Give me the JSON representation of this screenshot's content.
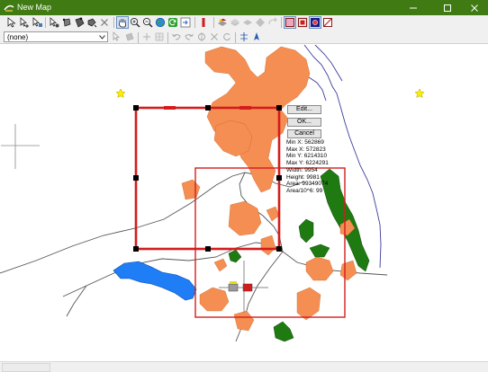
{
  "window": {
    "title": "New Map",
    "controls": [
      "minimize-icon",
      "maximize-icon",
      "close-icon"
    ]
  },
  "toolbar_top": {
    "buttons": [
      "select-arrow",
      "select-add",
      "select-layer",
      "edit-node",
      "edit-shape",
      "edit-vertex",
      "edit-move",
      "delete-x",
      "pan-hand",
      "zoom-in",
      "zoom-out",
      "zoom-globe",
      "refresh",
      "export",
      "red-marker",
      "layer-add",
      "layer-remove",
      "layer-move",
      "shape-arrow",
      "undo-link",
      "style-fill",
      "style-line",
      "style-point",
      "style-none"
    ],
    "pressed": [
      "pan-hand",
      "style-fill",
      "style-point"
    ]
  },
  "toolbar_second": {
    "layer_select": {
      "value": "(none)"
    },
    "buttons": [
      "tool-pointer",
      "tool-table",
      "tool-plus",
      "tool-grid",
      "undo",
      "redo",
      "rotate",
      "cancel-x",
      "reload",
      "dimension",
      "north-arrow"
    ]
  },
  "selection_popup": {
    "edit_label": "Edit...",
    "ok_label": "OK...",
    "cancel_label": "Cancel",
    "info_lines": [
      "Min X: 562869",
      "Max X: 572823",
      "Min Y: 6214310",
      "Max Y: 6224291",
      "Width: 9954",
      "Height: 9981",
      "Area: 99349074",
      "Area/10^6: 99"
    ]
  },
  "colors": {
    "titlebar": "#3f7a12",
    "urban_area": "#f58e52",
    "forest": "#1f7a12",
    "water": "#1f7df5",
    "selection_frame": "#d41c1c",
    "road": "#555555",
    "coast_line": "#3c3c9c",
    "star_marker": "#ffee00"
  },
  "status": {
    "text": ""
  }
}
